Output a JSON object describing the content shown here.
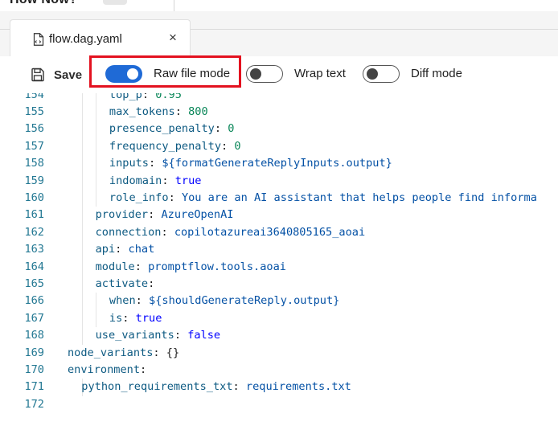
{
  "header": {
    "partial_title": "How Now?"
  },
  "tab": {
    "label": "flow.dag.yaml",
    "close_glyph": "×"
  },
  "toolbar": {
    "save_label": "Save",
    "toggles": [
      {
        "label": "Raw file mode",
        "on": true,
        "accent": "#1f6ad6"
      },
      {
        "label": "Wrap text",
        "on": false
      },
      {
        "label": "Diff mode",
        "on": false
      }
    ],
    "highlight_color": "#e3111f"
  },
  "code": {
    "lines": [
      {
        "n": "154",
        "indent": 3,
        "key": "top_p",
        "value": "0.95",
        "type": "num"
      },
      {
        "n": "155",
        "indent": 3,
        "key": "max_tokens",
        "value": "800",
        "type": "num"
      },
      {
        "n": "156",
        "indent": 3,
        "key": "presence_penalty",
        "value": "0",
        "type": "num"
      },
      {
        "n": "157",
        "indent": 3,
        "key": "frequency_penalty",
        "value": "0",
        "type": "num"
      },
      {
        "n": "158",
        "indent": 3,
        "key": "inputs",
        "value": "${formatGenerateReplyInputs.output}",
        "type": "str"
      },
      {
        "n": "159",
        "indent": 3,
        "key": "indomain",
        "value": "true",
        "type": "bool"
      },
      {
        "n": "160",
        "indent": 3,
        "key": "role_info",
        "value": "You are an AI assistant that helps people find informa",
        "type": "str"
      },
      {
        "n": "161",
        "indent": 2,
        "key": "provider",
        "value": "AzureOpenAI",
        "type": "str"
      },
      {
        "n": "162",
        "indent": 2,
        "key": "connection",
        "value": "copilotazureai3640805165_aoai",
        "type": "str"
      },
      {
        "n": "163",
        "indent": 2,
        "key": "api",
        "value": "chat",
        "type": "str"
      },
      {
        "n": "164",
        "indent": 2,
        "key": "module",
        "value": "promptflow.tools.aoai",
        "type": "str"
      },
      {
        "n": "165",
        "indent": 2,
        "key": "activate",
        "value": "",
        "type": "none"
      },
      {
        "n": "166",
        "indent": 3,
        "key": "when",
        "value": "${shouldGenerateReply.output}",
        "type": "str"
      },
      {
        "n": "167",
        "indent": 3,
        "key": "is",
        "value": "true",
        "type": "bool"
      },
      {
        "n": "168",
        "indent": 2,
        "key": "use_variants",
        "value": "false",
        "type": "bool"
      },
      {
        "n": "169",
        "indent": 0,
        "key": "node_variants",
        "value": "{}",
        "type": "punct"
      },
      {
        "n": "170",
        "indent": 0,
        "key": "environment",
        "value": "",
        "type": "none"
      },
      {
        "n": "171",
        "indent": 1,
        "key": "python_requirements_txt",
        "value": "requirements.txt",
        "type": "str"
      },
      {
        "n": "172",
        "indent": 0,
        "key": "",
        "value": "",
        "type": "none"
      }
    ]
  }
}
